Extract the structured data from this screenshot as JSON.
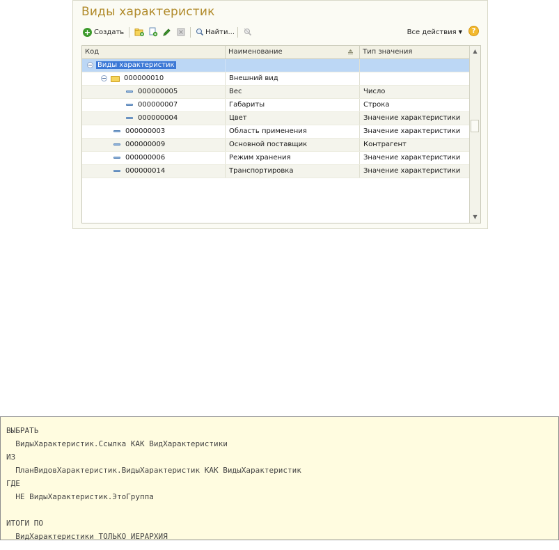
{
  "window": {
    "title": "Виды характеристик"
  },
  "toolbar": {
    "create_label": "Создать",
    "find_label": "Найти...",
    "all_actions_label": "Все действия",
    "help_label": "?"
  },
  "table": {
    "columns": [
      "Код",
      "Наименование",
      "Тип значения"
    ],
    "rows": [
      {
        "code": "Виды характеристик",
        "name": "",
        "type": ""
      },
      {
        "code": "000000010",
        "name": "Внешний вид",
        "type": ""
      },
      {
        "code": "000000005",
        "name": "Вес",
        "type": "Число"
      },
      {
        "code": "000000007",
        "name": "Габариты",
        "type": "Строка"
      },
      {
        "code": "000000004",
        "name": "Цвет",
        "type": "Значение характеристики"
      },
      {
        "code": "000000003",
        "name": "Область применения",
        "type": "Значение характеристики"
      },
      {
        "code": "000000009",
        "name": "Основной поставщик",
        "type": "Контрагент"
      },
      {
        "code": "000000006",
        "name": "Режим хранения",
        "type": "Значение характеристики"
      },
      {
        "code": "000000014",
        "name": "Транспортировка",
        "type": "Значение характеристики"
      }
    ]
  },
  "query": {
    "lines": [
      "ВЫБРАТЬ",
      "  ВидыХарактеристик.Ссылка КАК ВидХарактеристики",
      "ИЗ",
      "  ПланВидовХарактеристик.ВидыХарактеристик КАК ВидыХарактеристик",
      "ГДЕ",
      "  НЕ ВидыХарактеристик.ЭтоГруппа",
      "",
      "ИТОГИ ПО",
      "  ВидХарактеристики ТОЛЬКО ИЕРАРХИЯ"
    ]
  }
}
